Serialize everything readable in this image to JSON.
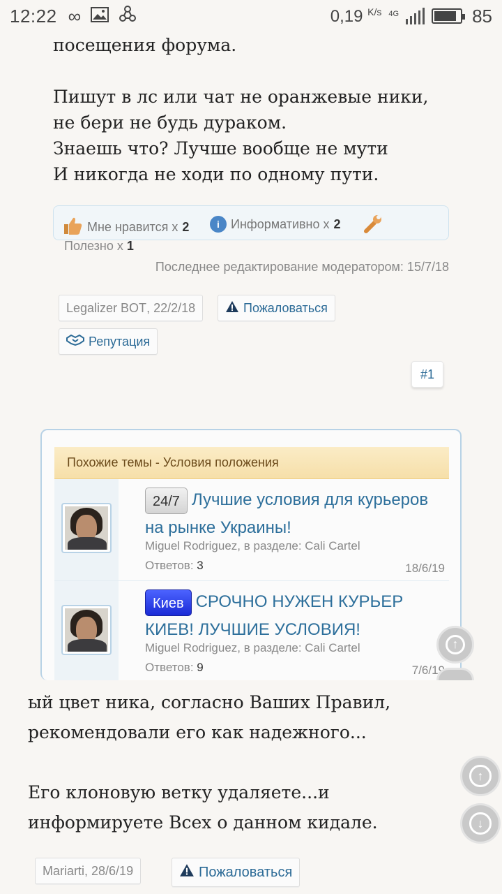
{
  "status_bar": {
    "time": "12:22",
    "speed": "0,19",
    "speed_unit": "K/s",
    "network": "4G",
    "battery": "85",
    "battery_level": 0.85,
    "icons": [
      "infinity-icon",
      "image-icon",
      "share-icon"
    ]
  },
  "post_top": {
    "lines": [
      "посещения форума.",
      "",
      "Пишут в лс или чат не оранжевые ники,",
      "не бери не будь дураком.",
      "Знаешь что? Лучше вообще не мути",
      "И никогда не ходи по одному пути."
    ]
  },
  "ratings": {
    "like_label": "Мне нравится x",
    "like_count": "2",
    "info_label": "Информативно x",
    "info_count": "2",
    "useful_label": "Полезно x",
    "useful_count": "1",
    "edited": "Последнее редактирование модератором: 15/7/18"
  },
  "post_meta": {
    "author": "Legalizer BOT",
    "date": ", 22/2/18",
    "report": "Пожаловаться",
    "reputation": "Репутация",
    "permalink": "#1"
  },
  "similar": {
    "title": "Похожие темы - Условия положения",
    "threads": [
      {
        "prefix": "24/7",
        "title": "Лучшие условия для курьеров на рынке Украины!",
        "author_section": "Miguel Rodriguez, в разделе: Cali Cartel",
        "replies_label": "Ответов:",
        "replies": "3",
        "date": "18/6/19"
      },
      {
        "prefix": "Киев",
        "title": "СРОЧНО НУЖЕН КУРЬЕР КИЕВ! ЛУЧШИЕ УСЛОВИЯ!",
        "author_section": "Miguel Rodriguez, в разделе: Cali Cartel",
        "replies_label": "Ответов:",
        "replies": "9",
        "date": "7/6/19"
      }
    ]
  },
  "post_bottom": {
    "lines": [
      "ый цвет ника, согласно Ваших Правил,",
      "рекомендовали его как надежного...",
      "",
      "Его клоновую ветку удаляете...и",
      "информируете Всех о данном кидале."
    ]
  },
  "post2_meta": {
    "author": "Mariarti",
    "date": ", 28/6/19",
    "report": "Пожаловаться"
  },
  "colors": {
    "link": "#2b6a96",
    "header_bg": "#f6dfa9",
    "prefix_blue": "#1a2bd6"
  }
}
